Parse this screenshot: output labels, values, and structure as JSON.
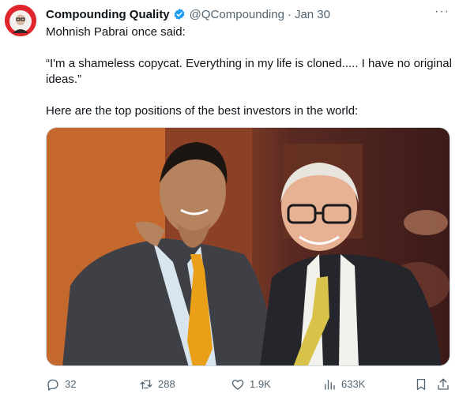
{
  "tweet": {
    "author_name": "Compounding Quality",
    "handle": "@QCompounding",
    "separator": "·",
    "date": "Jan 30",
    "more": "···",
    "verified_color": "#1d9bf0",
    "avatar_color": "#e0262c",
    "text_lines": [
      "Mohnish Pabrai once said:",
      "“I'm a shameless copycat. Everything in my life is cloned..... I have no original ideas.”",
      "Here are the top positions of the best investors in the world:"
    ]
  },
  "actions": {
    "replies": "32",
    "retweets": "288",
    "likes": "1.9K",
    "views": "633K",
    "icons": [
      "reply-icon",
      "retweet-icon",
      "like-icon",
      "views-icon",
      "bookmark-icon",
      "share-icon"
    ]
  }
}
